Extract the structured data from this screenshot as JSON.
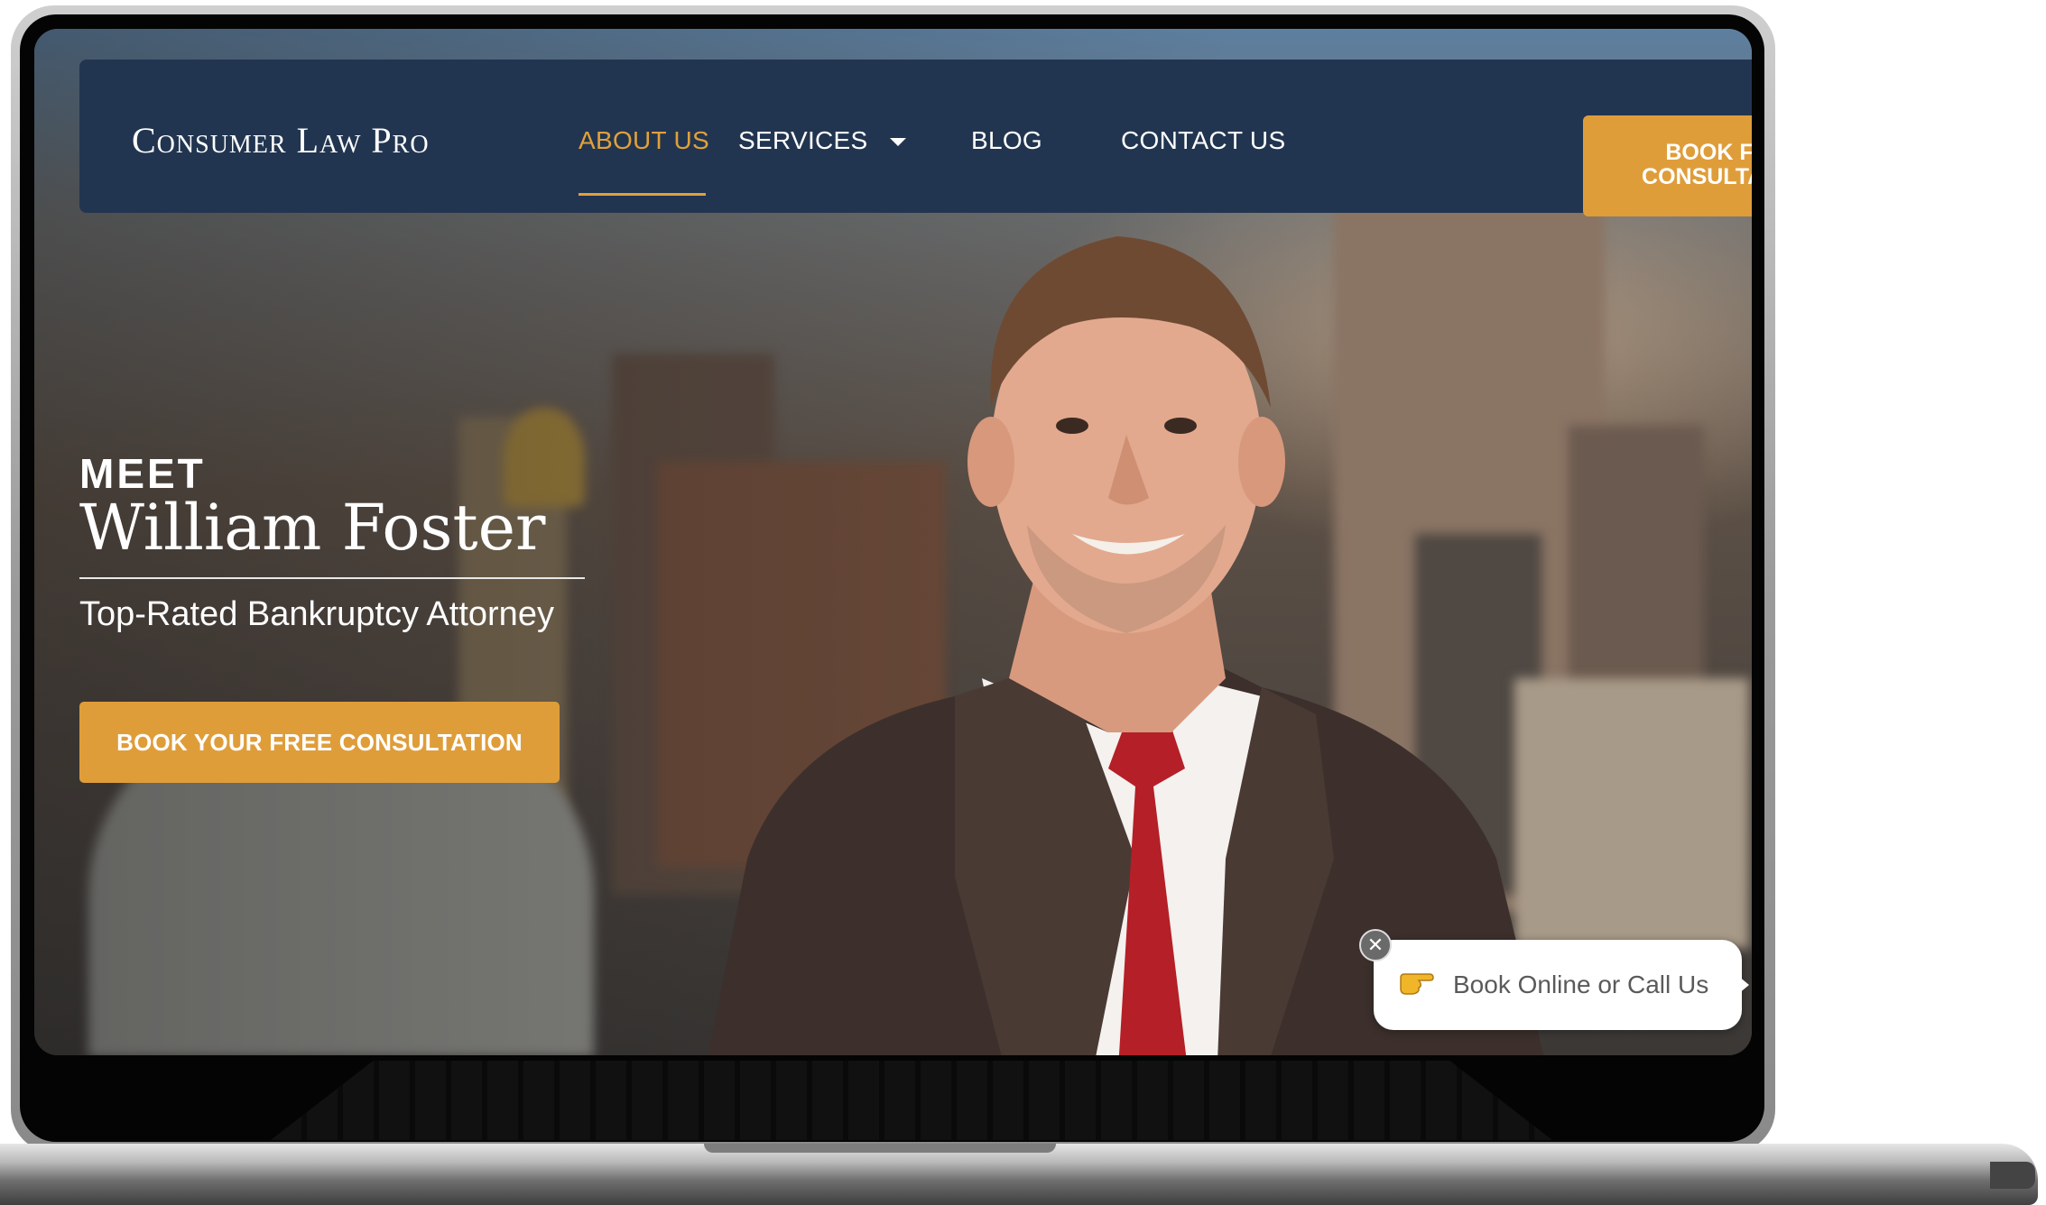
{
  "site": {
    "logo_text": "Consumer Law Pro"
  },
  "nav": {
    "items": [
      {
        "label": "ABOUT US",
        "active": true
      },
      {
        "label": "SERVICES",
        "has_dropdown": true
      },
      {
        "label": "BLOG"
      },
      {
        "label": "CONTACT US"
      }
    ],
    "book_button": {
      "line1": "BOOK FREE",
      "line2": "CONSULTATIO"
    }
  },
  "hero": {
    "eyebrow": "MEET",
    "name": "William Foster",
    "subtitle": "Top-Rated Bankruptcy Attorney",
    "cta_label": "BOOK YOUR FREE CONSULTATION"
  },
  "widget": {
    "text": "Book Online or Call Us",
    "icon": "pointing-hand-icon",
    "close_symbol": "✕"
  },
  "colors": {
    "navbar": "#223550",
    "accent": "#df9d3a",
    "active_nav": "#e0a13b"
  }
}
